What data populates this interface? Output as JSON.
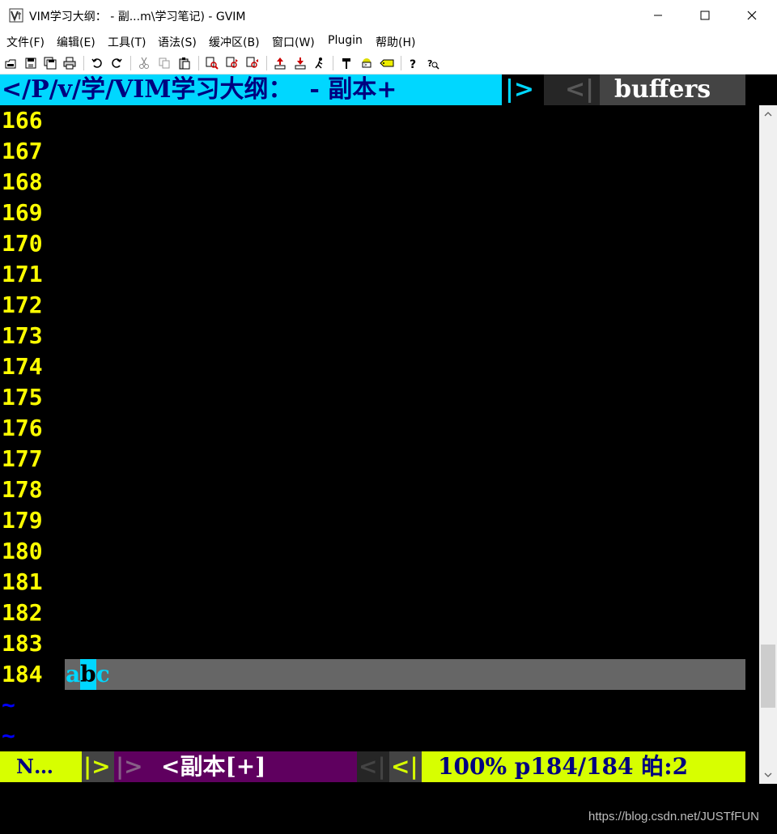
{
  "window": {
    "title": "VIM学习大纲：  - 副...m\\学习笔记) - GVIM",
    "app_icon": "gvim-icon",
    "controls": [
      "minimize-icon",
      "maximize-icon",
      "close-icon"
    ]
  },
  "menu": {
    "items": [
      "文件(F)",
      "编辑(E)",
      "工具(T)",
      "语法(S)",
      "缓冲区(B)",
      "窗口(W)",
      "Plugin",
      "帮助(H)"
    ]
  },
  "toolbar": {
    "icons": [
      "open-icon",
      "save-icon",
      "save-all-icon",
      "print-icon",
      "undo-icon",
      "redo-icon",
      "cut-icon",
      "copy-icon",
      "paste-icon",
      "replace-icon",
      "find-next-icon",
      "find-prev-icon",
      "load-session-icon",
      "save-session-icon",
      "run-script-icon",
      "make-icon",
      "shell-icon",
      "tag-jump-icon",
      "help-icon",
      "find-help-icon"
    ]
  },
  "tabline": {
    "current_tab": "</P/v/学/VIM学习大纲：  - 副本+",
    "sep_right": "|>",
    "sep_left": "<|",
    "buffers_label": "buffers"
  },
  "editor": {
    "line_numbers": [
      "166",
      "167",
      "168",
      "169",
      "170",
      "171",
      "172",
      "173",
      "174",
      "175",
      "176",
      "177",
      "178",
      "179",
      "180",
      "181",
      "182",
      "183"
    ],
    "cursor_line": {
      "number": "184",
      "before": "a",
      "cursor_char": "b",
      "after": "c"
    },
    "filler_lines": [
      "~",
      "~"
    ]
  },
  "statusline": {
    "mode": "N…",
    "sep1": "|>",
    "sep2": "|>",
    "filename": "<副本[+]",
    "sep3": "<|",
    "sep4": "<|",
    "position": "100% p184/184 㿟:2"
  },
  "watermark": "https://blog.csdn.net/JUSTfFUN",
  "colors": {
    "tab_active_bg": "#00d7ff",
    "tab_active_fg": "#000080",
    "line_number": "#ffff00",
    "status_mode_bg": "#d7ff00",
    "status_file_bg": "#5f005f",
    "cursorline_bg": "#666666",
    "tilde": "#0000ff"
  }
}
